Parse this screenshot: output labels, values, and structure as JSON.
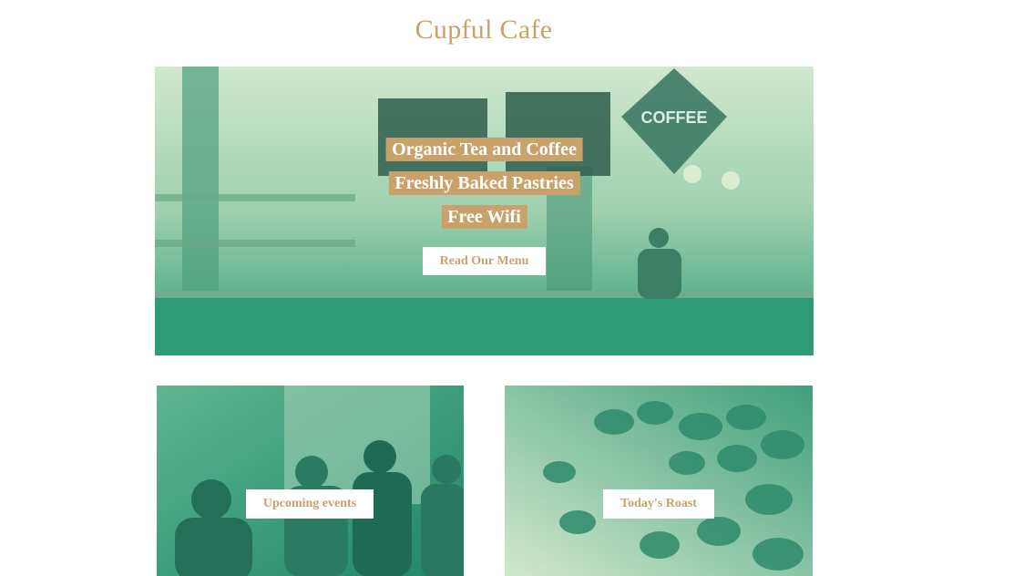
{
  "header": {
    "site_title": "Cupful Cafe"
  },
  "hero": {
    "taglines": [
      "Organic Tea and Coffee",
      "Freshly Baked Pastries",
      "Free Wifi"
    ],
    "menu_button_label": "Read Our Menu",
    "image_sign_text": "COFFEE"
  },
  "cards": [
    {
      "button_label": "Upcoming events"
    },
    {
      "button_label": "Today's Roast"
    }
  ],
  "colors": {
    "accent_gold": "#c9a26b",
    "image_tint_green": "#2e9a77",
    "button_bg": "#ffffff"
  }
}
